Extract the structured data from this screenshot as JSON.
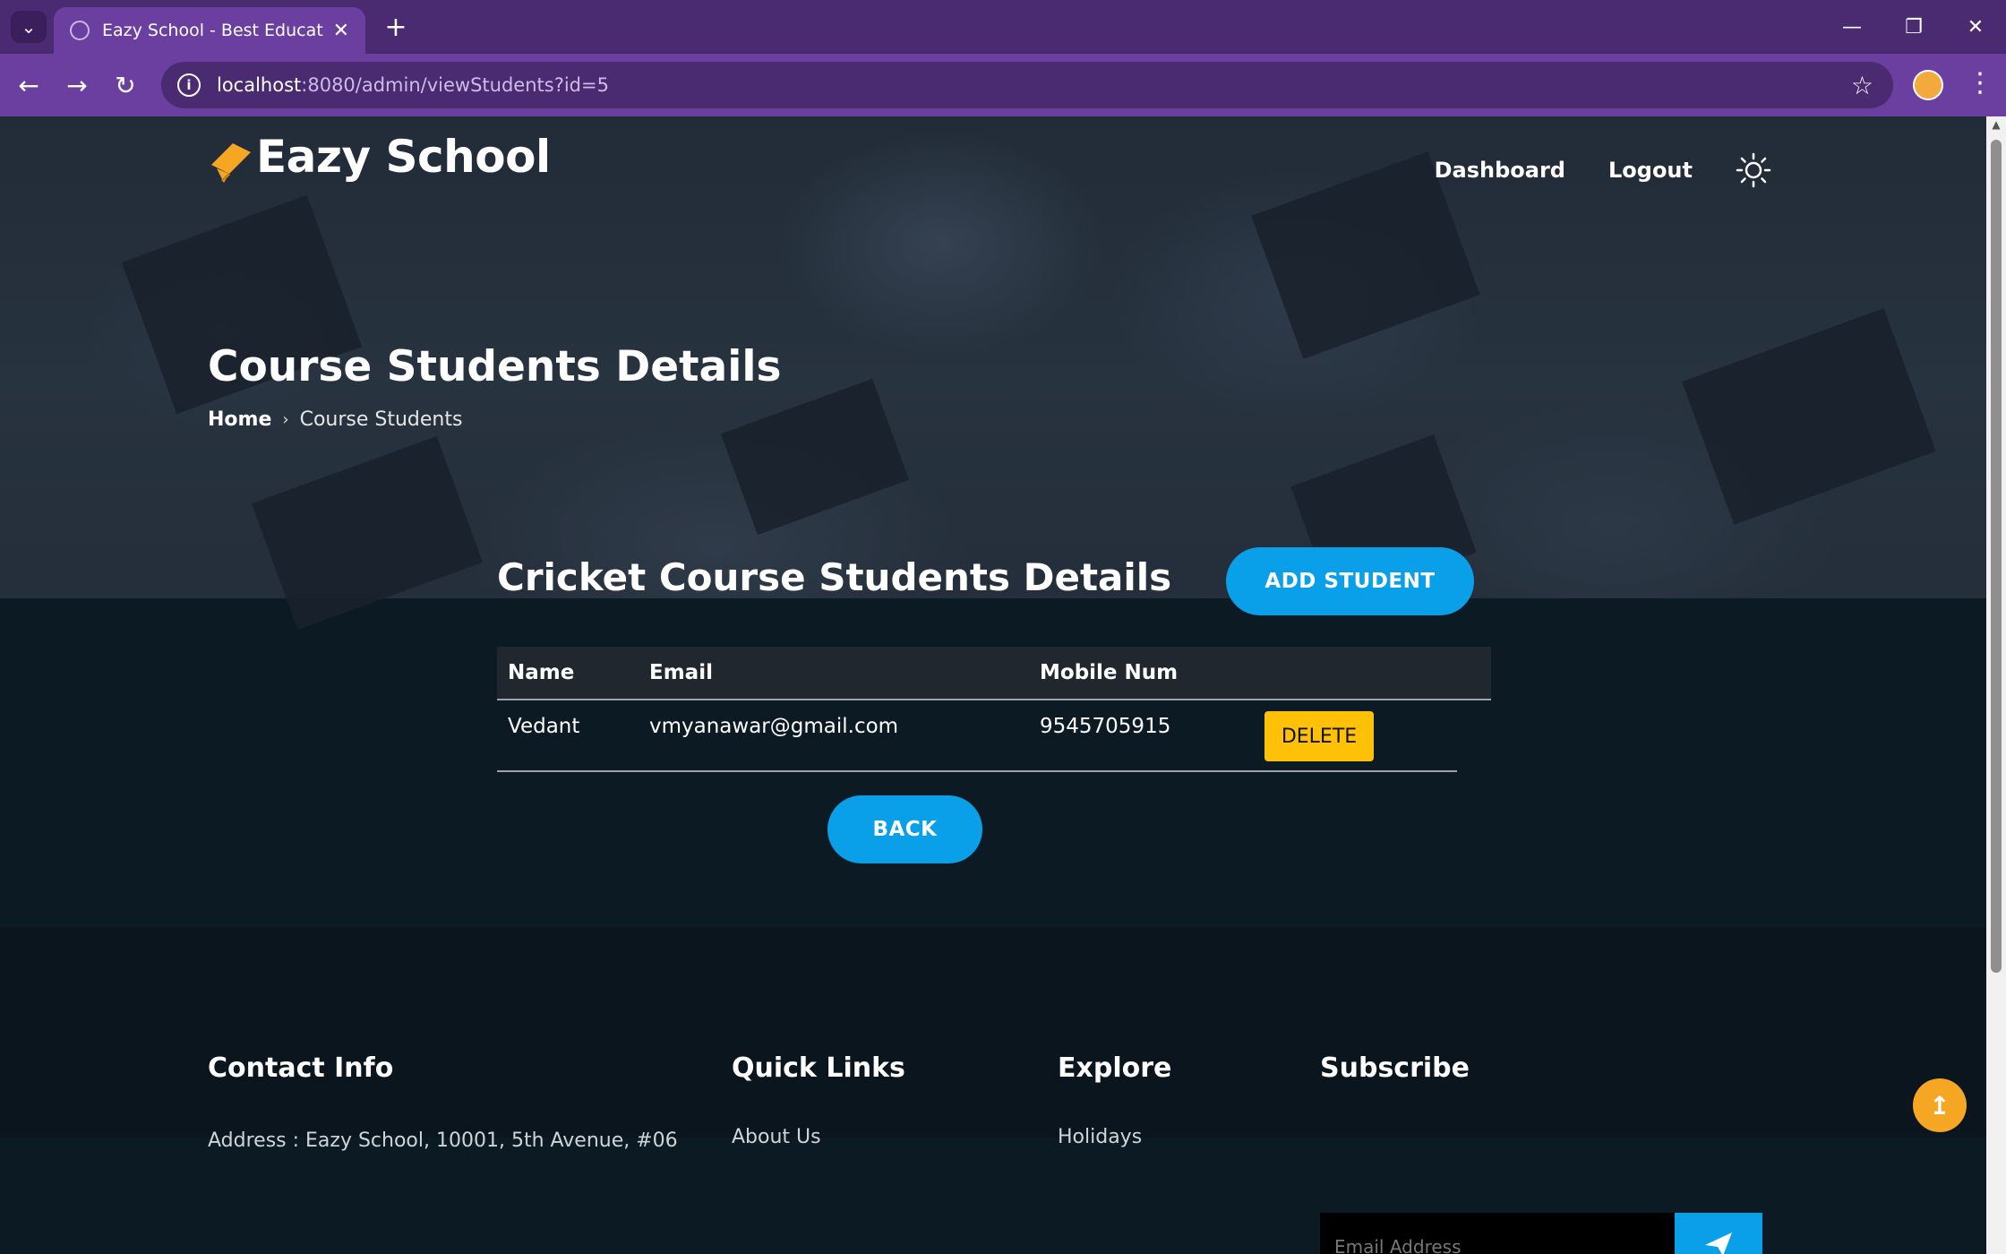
{
  "browser": {
    "tab_title": "Eazy School - Best Educational Institute",
    "url_host": "localhost",
    "url_rest": ":8080/admin/viewStudents?id=5"
  },
  "header": {
    "logo_text": "Eazy School",
    "nav": {
      "dashboard": "Dashboard",
      "logout": "Logout"
    }
  },
  "hero": {
    "title": "Course Students Details",
    "breadcrumb": {
      "home": "Home",
      "current": "Course Students"
    }
  },
  "main": {
    "section_title": "Cricket Course Students Details",
    "add_button": "ADD STUDENT",
    "back_button": "BACK",
    "table": {
      "headers": [
        "Name",
        "Email",
        "Mobile Num"
      ],
      "rows": [
        {
          "name": "Vedant",
          "email": "vmyanawar@gmail.com",
          "mobile": "9545705915",
          "action": "DELETE"
        }
      ]
    }
  },
  "footer": {
    "contact": {
      "title": "Contact Info",
      "address": "Address : Eazy School, 10001, 5th Avenue, #06"
    },
    "quick_links": {
      "title": "Quick Links",
      "first": "About Us"
    },
    "explore": {
      "title": "Explore",
      "first": "Holidays"
    },
    "subscribe": {
      "title": "Subscribe",
      "placeholder": "Email Address"
    }
  },
  "colors": {
    "accent": "#0aa0e9",
    "delete": "#ffc107",
    "logo": "#f5a623",
    "browser_frame": "#6a3fa0"
  }
}
